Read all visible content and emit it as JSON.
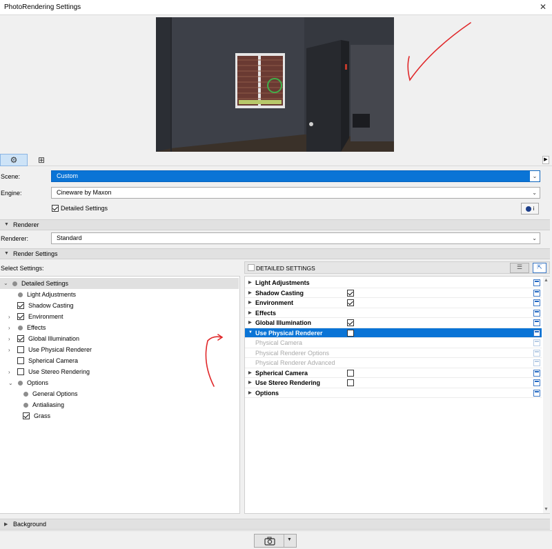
{
  "window": {
    "title": "PhotoRendering Settings",
    "close_glyph": "✕"
  },
  "tabs": [
    {
      "icon": "gear-icon",
      "glyph": "⚙"
    },
    {
      "icon": "grid-view-icon",
      "glyph": "⊞"
    }
  ],
  "scene": {
    "label": "Scene:",
    "value": "Custom"
  },
  "engine": {
    "label": "Engine:",
    "value": "Cineware by Maxon"
  },
  "detailed_settings_checkbox": {
    "label": "Detailed Settings",
    "checked": true
  },
  "info_button": {
    "glyph": "i"
  },
  "renderer_section": {
    "title": "Renderer",
    "field_label": "Renderer:",
    "value": "Standard"
  },
  "render_settings_section": {
    "title": "Render Settings",
    "select_label": "Select Settings:",
    "detailed_header": "DETAILED SETTINGS"
  },
  "tree": [
    {
      "label": "Detailed Settings",
      "kind": "dot",
      "expander": "v",
      "level": 0,
      "selected": true
    },
    {
      "label": "Light Adjustments",
      "kind": "dot",
      "level": 1
    },
    {
      "label": "Shadow Casting",
      "kind": "check",
      "checked": true,
      "level": 1
    },
    {
      "label": "Environment",
      "kind": "check",
      "checked": true,
      "expander": ">",
      "level": 1
    },
    {
      "label": "Effects",
      "kind": "dot",
      "expander": ">",
      "level": 1
    },
    {
      "label": "Global Illumination",
      "kind": "check",
      "checked": true,
      "expander": ">",
      "level": 1
    },
    {
      "label": "Use Physical Renderer",
      "kind": "check",
      "checked": false,
      "expander": ">",
      "level": 1
    },
    {
      "label": "Spherical Camera",
      "kind": "check",
      "checked": false,
      "level": 1
    },
    {
      "label": "Use Stereo Rendering",
      "kind": "check",
      "checked": false,
      "expander": ">",
      "level": 1
    },
    {
      "label": "Options",
      "kind": "dot",
      "expander": "v",
      "level": 1
    },
    {
      "label": "General Options",
      "kind": "dot",
      "level": 2
    },
    {
      "label": "Antialiasing",
      "kind": "dot",
      "level": 2
    },
    {
      "label": "Grass",
      "kind": "check",
      "checked": true,
      "level": 1
    }
  ],
  "detail_rows": [
    {
      "label": "Light Adjustments",
      "type": "section"
    },
    {
      "label": "Shadow Casting",
      "type": "section",
      "checked": true
    },
    {
      "label": "Environment",
      "type": "section",
      "checked": true
    },
    {
      "label": "Effects",
      "type": "section"
    },
    {
      "label": "Global Illumination",
      "type": "section",
      "checked": true
    },
    {
      "label": "Use Physical Renderer",
      "type": "section",
      "checked": false,
      "highlight": true,
      "expanded": true
    },
    {
      "label": "Physical Camera",
      "type": "sub"
    },
    {
      "label": "Physical Renderer Options",
      "type": "sub"
    },
    {
      "label": "Physical Renderer Advanced",
      "type": "sub"
    },
    {
      "label": "Spherical Camera",
      "type": "section",
      "checked": false
    },
    {
      "label": "Use Stereo Rendering",
      "type": "section",
      "checked": false
    },
    {
      "label": "Options",
      "type": "section"
    }
  ],
  "background_section": {
    "title": "Background"
  },
  "footer": {
    "camera_icon": "camera-icon",
    "dropdown_glyph": "▼"
  },
  "colors": {
    "accent": "#0a74d6",
    "annotation": "#e0282a"
  }
}
